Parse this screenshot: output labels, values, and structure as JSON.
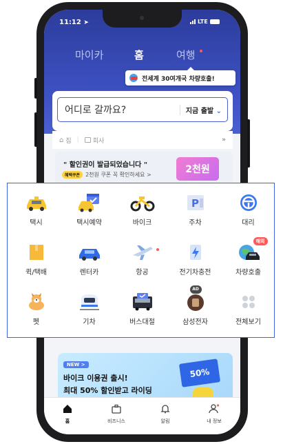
{
  "status_bar": {
    "time": "11:12",
    "network": "LTE"
  },
  "top_tabs": [
    {
      "label": "마이카"
    },
    {
      "label": "홈"
    },
    {
      "label": "여행"
    }
  ],
  "tooltip": {
    "text": "전세계 30여개국 차량호출!"
  },
  "search": {
    "placeholder": "어디로 갈까요?",
    "depart_label": "지금 출발"
  },
  "recents": {
    "home": "집",
    "work": "회사"
  },
  "coupon_banner": {
    "title": "\" 할인권이 발급되었습니다 \"",
    "pill": "혜택쿠폰",
    "subtitle": "2천원 쿠폰 꼭 확인하세요 >",
    "coupon_value": "2천원"
  },
  "services": [
    {
      "label": "택시",
      "icon": "taxi-icon"
    },
    {
      "label": "택시예약",
      "icon": "taxi-reservation-icon"
    },
    {
      "label": "바이크",
      "icon": "bike-icon"
    },
    {
      "label": "주차",
      "icon": "parking-icon"
    },
    {
      "label": "대리",
      "icon": "steering-wheel-icon"
    },
    {
      "label": "퀵/택배",
      "icon": "package-icon"
    },
    {
      "label": "렌터카",
      "icon": "rental-car-icon"
    },
    {
      "label": "항공",
      "icon": "airplane-icon"
    },
    {
      "label": "전기차충전",
      "icon": "ev-charging-icon"
    },
    {
      "label": "차량호출",
      "icon": "global-ride-icon",
      "badge": "해외"
    },
    {
      "label": "펫",
      "icon": "pet-icon"
    },
    {
      "label": "기차",
      "icon": "train-icon"
    },
    {
      "label": "버스대절",
      "icon": "bus-icon"
    },
    {
      "label": "삼성전자",
      "icon": "samsung-ad-icon",
      "badge": "AD"
    },
    {
      "label": "전체보기",
      "icon": "grid-icon"
    }
  ],
  "promo": {
    "badge": "NEW",
    "line1": "바이크 이용권 출시!",
    "line2": "최대 50% 할인받고 라이딩",
    "tag": "50%"
  },
  "bottom_nav": [
    {
      "label": "홈",
      "icon": "home-icon"
    },
    {
      "label": "비즈니스",
      "icon": "briefcase-icon"
    },
    {
      "label": "알림",
      "icon": "bell-icon"
    },
    {
      "label": "내 정보",
      "icon": "profile-icon"
    }
  ],
  "colors": {
    "primary": "#3f52c4",
    "accent": "#3f63e0",
    "alert": "#ff5a5a"
  }
}
